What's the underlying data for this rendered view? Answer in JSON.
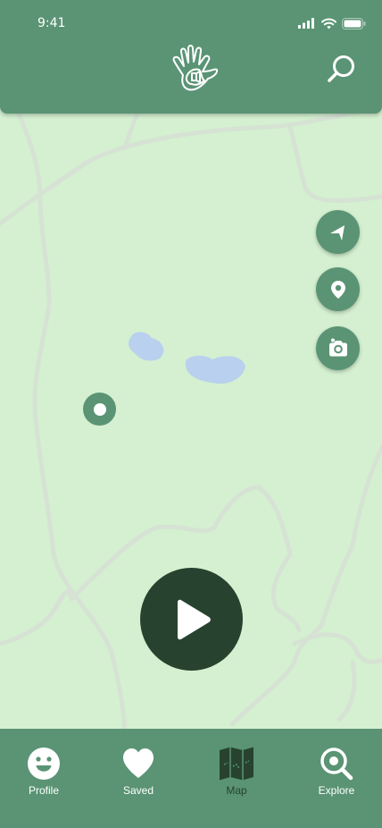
{
  "status_bar": {
    "time": "9:41"
  },
  "header": {
    "logo_icon": "hand-map-logo-icon",
    "search_icon": "search-icon"
  },
  "map_controls": [
    {
      "name": "navigate",
      "icon": "navigation-arrow-icon"
    },
    {
      "name": "location",
      "icon": "location-pin-icon"
    },
    {
      "name": "camera",
      "icon": "camera-icon"
    }
  ],
  "player": {
    "icon": "play-icon"
  },
  "nav": {
    "profile": "Profile",
    "saved": "Saved",
    "map": "Map",
    "explore": "Explore"
  },
  "colors": {
    "primary": "#5a9474",
    "dark": "#27432f",
    "map_land": "#d4f0d0",
    "water": "#b9d0ee",
    "roads": "#d5e2d3"
  }
}
